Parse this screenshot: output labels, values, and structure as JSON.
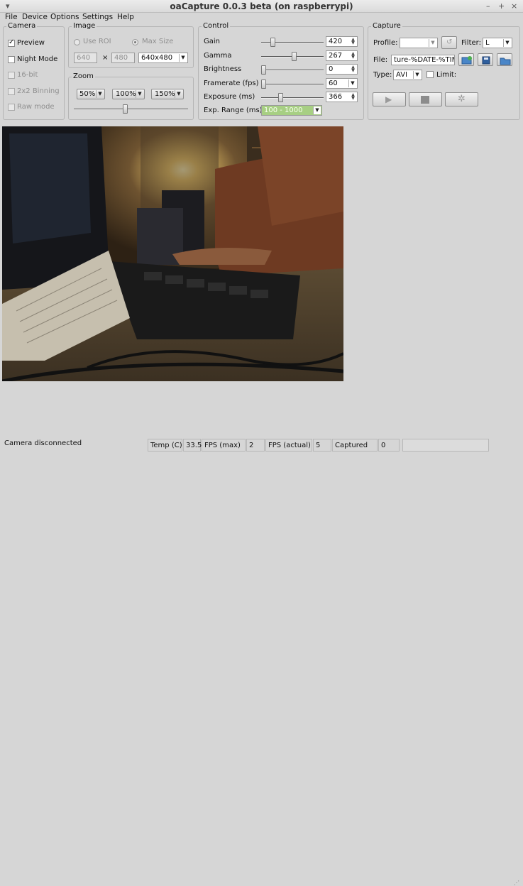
{
  "window": {
    "title": "oaCapture 0.0.3 beta (on raspberrypi)",
    "minimize": "–",
    "maximize": "+",
    "close": "×",
    "menu_arrow": "▾"
  },
  "menu": [
    "File",
    "Device",
    "Options",
    "Settings",
    "Help"
  ],
  "camera": {
    "title": "Camera",
    "options": [
      {
        "label": "Preview",
        "checked": true,
        "enabled": true
      },
      {
        "label": "Night Mode",
        "checked": false,
        "enabled": true
      },
      {
        "label": "16-bit",
        "checked": false,
        "enabled": false
      },
      {
        "label": "2x2 Binning",
        "checked": false,
        "enabled": false
      },
      {
        "label": "Raw mode",
        "checked": false,
        "enabled": false
      }
    ]
  },
  "image": {
    "title": "Image",
    "use_roi": "Use ROI",
    "max_size": "Max Size",
    "width": "640",
    "times": "×",
    "height": "480",
    "resolution": "640x480"
  },
  "zoom": {
    "title": "Zoom",
    "buttons": [
      "50%",
      "100%",
      "150%"
    ],
    "level": 0.45
  },
  "control": {
    "title": "Control",
    "rows": [
      {
        "label": "Gain",
        "value": "420",
        "level": 0.16,
        "kind": "spin"
      },
      {
        "label": "Gamma",
        "value": "267",
        "level": 0.53,
        "kind": "spin"
      },
      {
        "label": "Brightness",
        "value": "0",
        "level": 0.0,
        "kind": "spin"
      },
      {
        "label": "Framerate (fps)",
        "value": "60",
        "level": 0.0,
        "kind": "combo"
      },
      {
        "label": "Exposure (ms)",
        "value": "366",
        "level": 0.3,
        "kind": "spin"
      }
    ],
    "exp_range_label": "Exp. Range (ms)",
    "exp_range_value": "100 - 1000"
  },
  "capture": {
    "title": "Capture",
    "profile_label": "Profile:",
    "profile_value": "",
    "filter_label": "Filter:",
    "filter_value": "L",
    "file_label": "File:",
    "file_value": "ture-%DATE-%TIME",
    "type_label": "Type:",
    "type_value": "AVI",
    "limit_label": "Limit:"
  },
  "status": {
    "message": "Camera disconnected",
    "temp_label": "Temp (C)",
    "temp_value": "33.5",
    "fps_max_label": "FPS (max)",
    "fps_max_value": "2",
    "fps_actual_label": "FPS (actual)",
    "fps_actual_value": "5",
    "captured_label": "Captured",
    "captured_value": "0"
  },
  "colors": {
    "range_highlight": "#a7cf83",
    "background": "#d6d6d6"
  }
}
